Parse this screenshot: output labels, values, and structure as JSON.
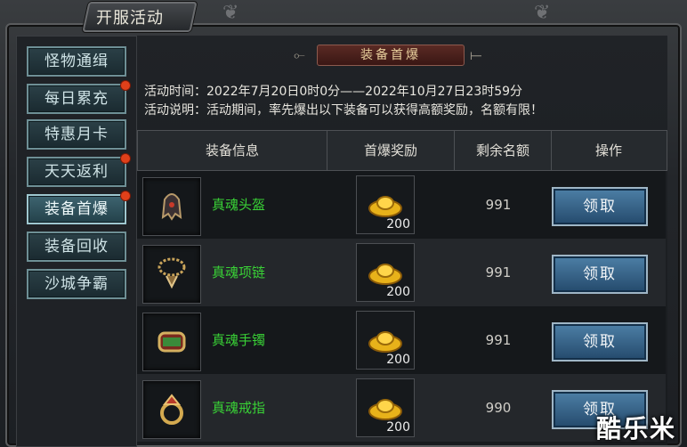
{
  "window": {
    "title": "开服活动"
  },
  "sidebar": {
    "items": [
      {
        "label": "怪物通缉",
        "badge": false,
        "active": false
      },
      {
        "label": "每日累充",
        "badge": true,
        "active": false
      },
      {
        "label": "特惠月卡",
        "badge": false,
        "active": false
      },
      {
        "label": "天天返利",
        "badge": true,
        "active": false
      },
      {
        "label": "装备首爆",
        "badge": true,
        "active": true
      },
      {
        "label": "装备回收",
        "badge": false,
        "active": false
      },
      {
        "label": "沙城争霸",
        "badge": false,
        "active": false
      }
    ]
  },
  "main": {
    "banner_title": "装备首爆",
    "activity_time": "活动时间：2022年7月20日0时0分——2022年10月27日23时59分",
    "activity_desc": "活动说明：活动期间，率先爆出以下装备可以获得高额奖励，名额有限！",
    "table": {
      "headers": [
        "装备信息",
        "首爆奖励",
        "剩余名额",
        "操作"
      ],
      "rows": [
        {
          "item_name": "真魂头盔",
          "item_icon": "helmet-icon",
          "reward": "200",
          "reward_icon": "gold-ingot-icon",
          "remaining": "991",
          "action": "领取"
        },
        {
          "item_name": "真魂项链",
          "item_icon": "necklace-icon",
          "reward": "200",
          "reward_icon": "gold-ingot-icon",
          "remaining": "991",
          "action": "领取"
        },
        {
          "item_name": "真魂手镯",
          "item_icon": "bracelet-icon",
          "reward": "200",
          "reward_icon": "gold-ingot-icon",
          "remaining": "991",
          "action": "领取"
        },
        {
          "item_name": "真魂戒指",
          "item_icon": "ring-icon",
          "reward": "200",
          "reward_icon": "gold-ingot-icon",
          "remaining": "990",
          "action": "领取"
        }
      ]
    }
  },
  "watermark": "酷乐米",
  "colors": {
    "item_name": "#39d136",
    "badge": "#e0401a",
    "button": "#2f5f86"
  }
}
